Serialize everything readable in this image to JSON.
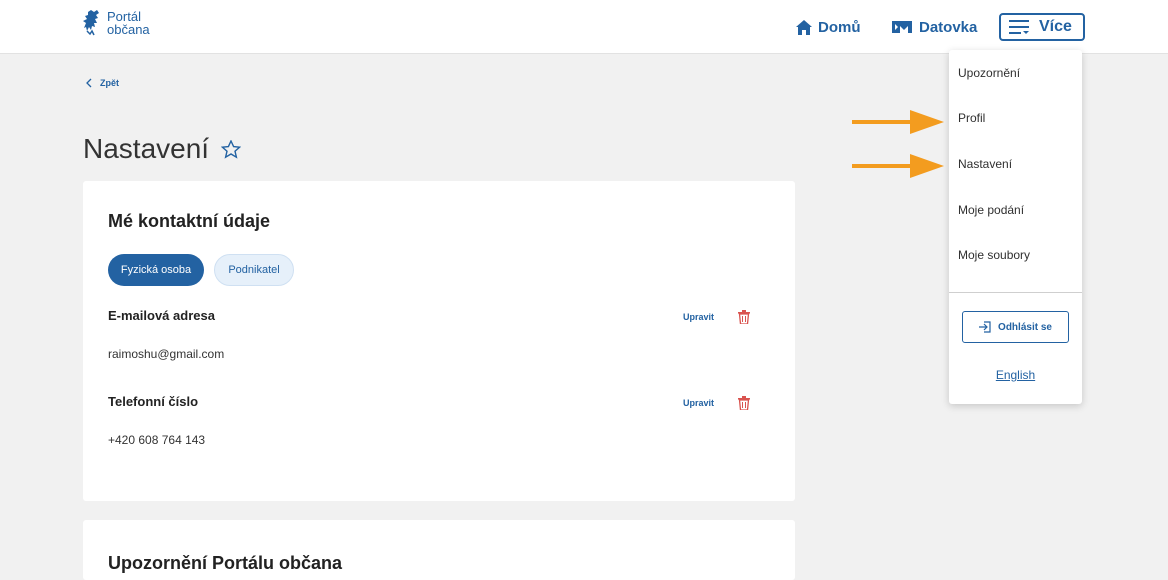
{
  "header": {
    "logo_line1": "Portál",
    "logo_line2": "občana",
    "nav": {
      "home_label": "Domů",
      "datovka_label": "Datovka",
      "more_label": "Více"
    }
  },
  "page": {
    "back_label": "Zpět",
    "title": "Nastavení"
  },
  "contact_card": {
    "title": "Mé kontaktní údaje",
    "tabs": [
      "Fyzická osoba",
      "Podnikatel"
    ],
    "active_tab": "Fyzická osoba",
    "email": {
      "label": "E-mailová adresa",
      "value": "raimoshu@gmail.com",
      "edit_label": "Upravit"
    },
    "phone": {
      "label": "Telefonní číslo",
      "value": "+420 608 764 143",
      "edit_label": "Upravit"
    }
  },
  "notifications_card": {
    "title": "Upozornění Portálu občana"
  },
  "more_menu": {
    "items": [
      "Upozornění",
      "Profil",
      "Nastavení",
      "Moje podání",
      "Moje soubory"
    ],
    "logout_label": "Odhlásit se",
    "language_label": "English"
  },
  "icons": {
    "home": "house-icon",
    "datovka": "datovka-logo-icon",
    "more": "menu-lines-icon",
    "back": "chevron-left-icon",
    "favorite": "star-outline-icon",
    "delete": "trash-icon",
    "logout": "logout-icon"
  },
  "colors": {
    "brand_blue": "#2362a2",
    "delete_red": "#d9534f",
    "annotation_arrow": "#f39c1f",
    "background": "#f1f1f1"
  }
}
